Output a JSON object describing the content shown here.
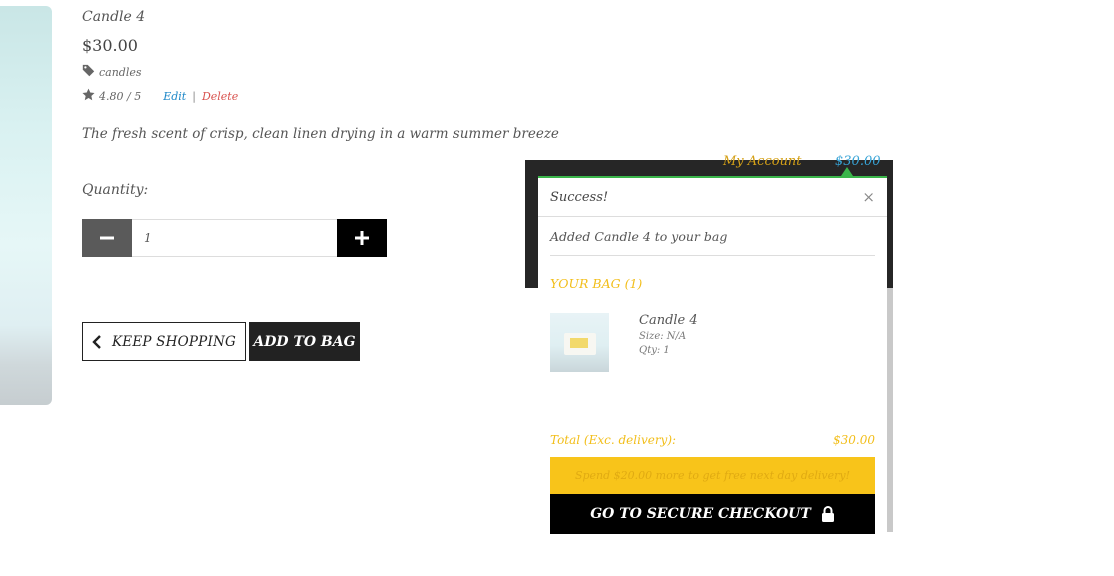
{
  "product": {
    "title": "Candle 4",
    "price": "$30.00",
    "category": "candles",
    "rating": "4.80 / 5",
    "edit_label": "Edit",
    "separator": "|",
    "delete_label": "Delete",
    "description": "The fresh scent of crisp, clean linen drying in a warm summer breeze"
  },
  "quantity": {
    "label": "Quantity:",
    "value": "1"
  },
  "actions": {
    "keep_shopping": "KEEP SHOPPING",
    "add_to_bag": "ADD TO BAG"
  },
  "toast": {
    "title": "Success!",
    "close": "×",
    "message": "Added Candle 4 to your bag",
    "bag_heading": "YOUR BAG (1)",
    "item": {
      "name": "Candle 4",
      "size": "Size: N/A",
      "qty": "Qty: 1"
    },
    "total_label": "Total (Exc. delivery):",
    "total_value": "$30.00",
    "delivery_notice": "Spend $20.00 more to get free next day delivery!",
    "checkout_label": "GO TO SECURE CHECKOUT"
  },
  "nav": {
    "account_label": "My Account",
    "bag_total": "$30.00"
  },
  "colors": {
    "accent_gold": "#f2be1a",
    "success_green": "#3ab54a",
    "edit_blue": "#1e88c8",
    "delete_red": "#d9534f"
  }
}
